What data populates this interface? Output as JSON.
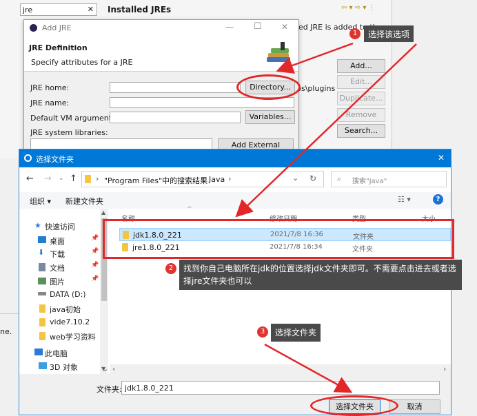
{
  "eclipse": {
    "filter_text": "jre",
    "title": "Installed JREs",
    "desc_partial": "ed JRE is added to the",
    "path_partial": "ps\\plugins",
    "buttons": {
      "add": "Add...",
      "edit": "Edit...",
      "duplicate": "Duplicate...",
      "remove": "Remove",
      "search": "Search..."
    },
    "left_partial": "ne."
  },
  "add_jre": {
    "title": "Add JRE",
    "heading": "JRE Definition",
    "subheading": "Specify attributes for a JRE",
    "labels": {
      "home": "JRE home:",
      "name": "JRE name:",
      "vm_args": "Default VM arguments:",
      "libs": "JRE system libraries:"
    },
    "buttons": {
      "directory": "Directory...",
      "variables": "Variables...",
      "add_jars": "Add External JARs..."
    }
  },
  "chooser": {
    "title": "选择文件夹",
    "breadcrumb": [
      "\"Program Files\"中的搜索结果",
      "Java"
    ],
    "search_placeholder": "搜索\"Java\"",
    "toolbar": {
      "organize": "组织 ▾",
      "new_folder": "新建文件夹"
    },
    "columns": [
      "名称",
      "修改日期",
      "类型",
      "大小"
    ],
    "files": [
      {
        "name": "jdk1.8.0_221",
        "date": "2021/7/8 16:36",
        "type": "文件夹"
      },
      {
        "name": "jre1.8.0_221",
        "date": "2021/7/8 16:34",
        "type": "文件夹"
      }
    ],
    "nav": [
      "快速访问",
      "桌面",
      "下载",
      "文档",
      "图片",
      "DATA (D:)",
      "java初始",
      "vide7.10.2",
      "web学习资料",
      "此电脑",
      "3D 对象"
    ],
    "folder_label": "文件夹:",
    "folder_value": "jdk1.8.0_221",
    "select_button": "选择文件夹",
    "cancel_button": "取消"
  },
  "annotations": {
    "one": {
      "num": "1",
      "text": "选择该选项"
    },
    "two": {
      "num": "2",
      "text": "找到你自己电脑所在jdk的位置选择jdk文件夹即可。不需要点击进去或者选择jre文件夹也可以"
    },
    "three": {
      "num": "3",
      "text": "选择文件夹"
    }
  },
  "colors": {
    "accent": "#0078d7",
    "annotation_red": "#e3262a",
    "callout_bg": "#4a4a4a"
  }
}
